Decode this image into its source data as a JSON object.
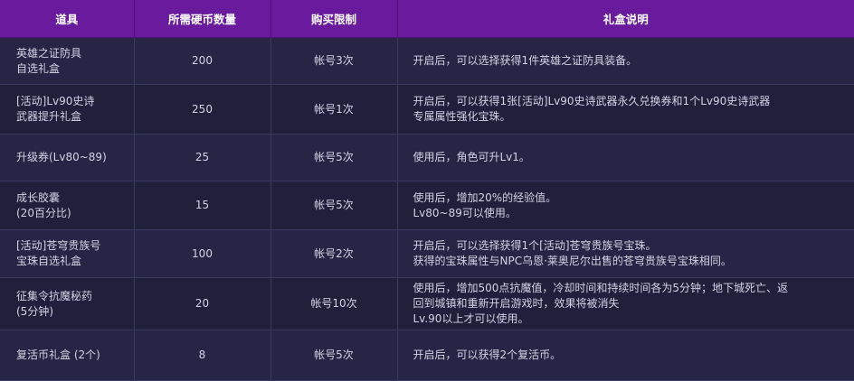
{
  "headers": {
    "item": "道具",
    "coins": "所需硬币数量",
    "limit": "购买限制",
    "description": "礼盒说明"
  },
  "rows": [
    {
      "name": [
        "英雄之证防具",
        "自选礼盒"
      ],
      "coins": "200",
      "limit": "帐号3次",
      "description": [
        "开启后，可以选择获得1件英雄之证防具装备。"
      ]
    },
    {
      "name": [
        "[活动]Lv90史诗",
        "武器提升礼盒"
      ],
      "coins": "250",
      "limit": "帐号1次",
      "description": [
        "开启后，可以获得1张[活动]Lv90史诗武器永久兑换券和1个Lv90史诗武器",
        "专属属性强化宝珠。"
      ]
    },
    {
      "name": [
        "升级券(Lv80~89)"
      ],
      "coins": "25",
      "limit": "帐号5次",
      "description": [
        "使用后，角色可升Lv1。"
      ]
    },
    {
      "name": [
        "成长胶囊",
        "(20百分比)"
      ],
      "coins": "15",
      "limit": "帐号5次",
      "description": [
        "使用后，增加20%的经验值。",
        "Lv80~89可以使用。"
      ]
    },
    {
      "name": [
        "[活动]苍穹贵族号",
        "宝珠自选礼盒"
      ],
      "coins": "100",
      "limit": "帐号2次",
      "description": [
        "开启后，可以选择获得1个[活动]苍穹贵族号宝珠。",
        "获得的宝珠属性与NPC乌恩·莱奥尼尔出售的苍穹贵族号宝珠相同。"
      ]
    },
    {
      "name": [
        "征集令抗魔秘药",
        "(5分钟)"
      ],
      "coins": "20",
      "limit": "帐号10次",
      "description": [
        "使用后，增加500点抗魔值，冷却时间和持续时间各为5分钟；地下城死亡、返",
        "回到城镇和重新开启游戏时，效果将被消失",
        "Lv.90以上才可以使用。"
      ]
    },
    {
      "name": [
        "复活币礼盒 (2个)"
      ],
      "coins": "8",
      "limit": "帐号5次",
      "description": [
        "开启后，可以获得2个复活币。"
      ]
    }
  ]
}
